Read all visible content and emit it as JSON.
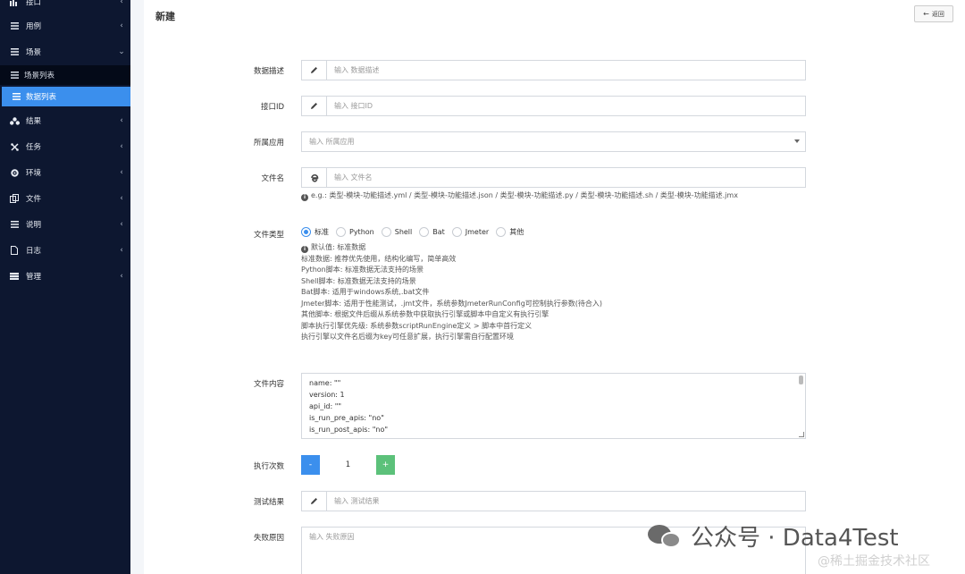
{
  "sidebar": {
    "items": [
      {
        "label": "接口",
        "icon": "bar-chart-icon"
      },
      {
        "label": "用例",
        "icon": "list-icon"
      },
      {
        "label": "场景",
        "icon": "list-icon"
      },
      {
        "label": "结果",
        "icon": "share-icon"
      },
      {
        "label": "任务",
        "icon": "tasks-icon"
      },
      {
        "label": "环境",
        "icon": "gear-icon"
      },
      {
        "label": "文件",
        "icon": "copy-icon"
      },
      {
        "label": "说明",
        "icon": "list-icon"
      },
      {
        "label": "日志",
        "icon": "file-icon"
      },
      {
        "label": "管理",
        "icon": "server-icon"
      }
    ],
    "sub_items": [
      {
        "label": "场景列表"
      },
      {
        "label": "数据列表"
      }
    ]
  },
  "header": {
    "title": "新建",
    "back_label": "返回"
  },
  "form": {
    "desc": {
      "label": "数据描述",
      "placeholder": "输入 数据描述"
    },
    "api_id": {
      "label": "接口ID",
      "placeholder": "输入 接口ID"
    },
    "app": {
      "label": "所属应用",
      "placeholder": "输入 所属应用"
    },
    "filename": {
      "label": "文件名",
      "placeholder": "输入 文件名",
      "help": "e.g.: 类型-模块-功能描述.yml / 类型-模块-功能描述.json / 类型-模块-功能描述.py / 类型-模块-功能描述.sh / 类型-模块-功能描述.jmx"
    },
    "filetype": {
      "label": "文件类型",
      "options": [
        "标准",
        "Python",
        "Shell",
        "Bat",
        "Jmeter",
        "其他"
      ],
      "selected": "标准",
      "default_note": "默认值: 标准数据",
      "notes": [
        "标准数据: 推荐优先使用，结构化编写，简单高效",
        "Python脚本: 标准数据无法支持的场景",
        "Shell脚本: 标准数据无法支持的场景",
        "Bat脚本: 适用于windows系统,.bat文件",
        "Jmeter脚本: 适用于性能测试，.jmt文件，系统参数JmeterRunConfig可控制执行参数(待合入)",
        "其他脚本: 根据文件后缀从系统参数中获取执行引擎或脚本中自定义有执行引擎",
        "脚本执行引擎优先级: 系统参数scriptRunEngine定义 > 脚本中首行定义",
        "执行引擎以文件名后缀为key可任意扩展，执行引擎需自行配置环境"
      ]
    },
    "content": {
      "label": "文件内容",
      "lines": [
        "name: \"\"",
        "version: 1",
        "api_id: \"\"",
        "is_run_pre_apis: \"no\"",
        "is_run_post_apis: \"no\""
      ]
    },
    "run_count": {
      "label": "执行次数",
      "minus": "-",
      "value": "1",
      "plus": "+"
    },
    "test_result": {
      "label": "测试结果",
      "placeholder": "输入 测试结果"
    },
    "fail_reason": {
      "label": "失败原因",
      "placeholder": "输入 失败原因"
    }
  },
  "watermark": {
    "text": "公众号 · Data4Test",
    "site": "@稀土掘金技术社区"
  },
  "colors": {
    "sidebar_bg": "#0d1730",
    "active": "#3b8fed",
    "plus": "#5cc17a"
  }
}
